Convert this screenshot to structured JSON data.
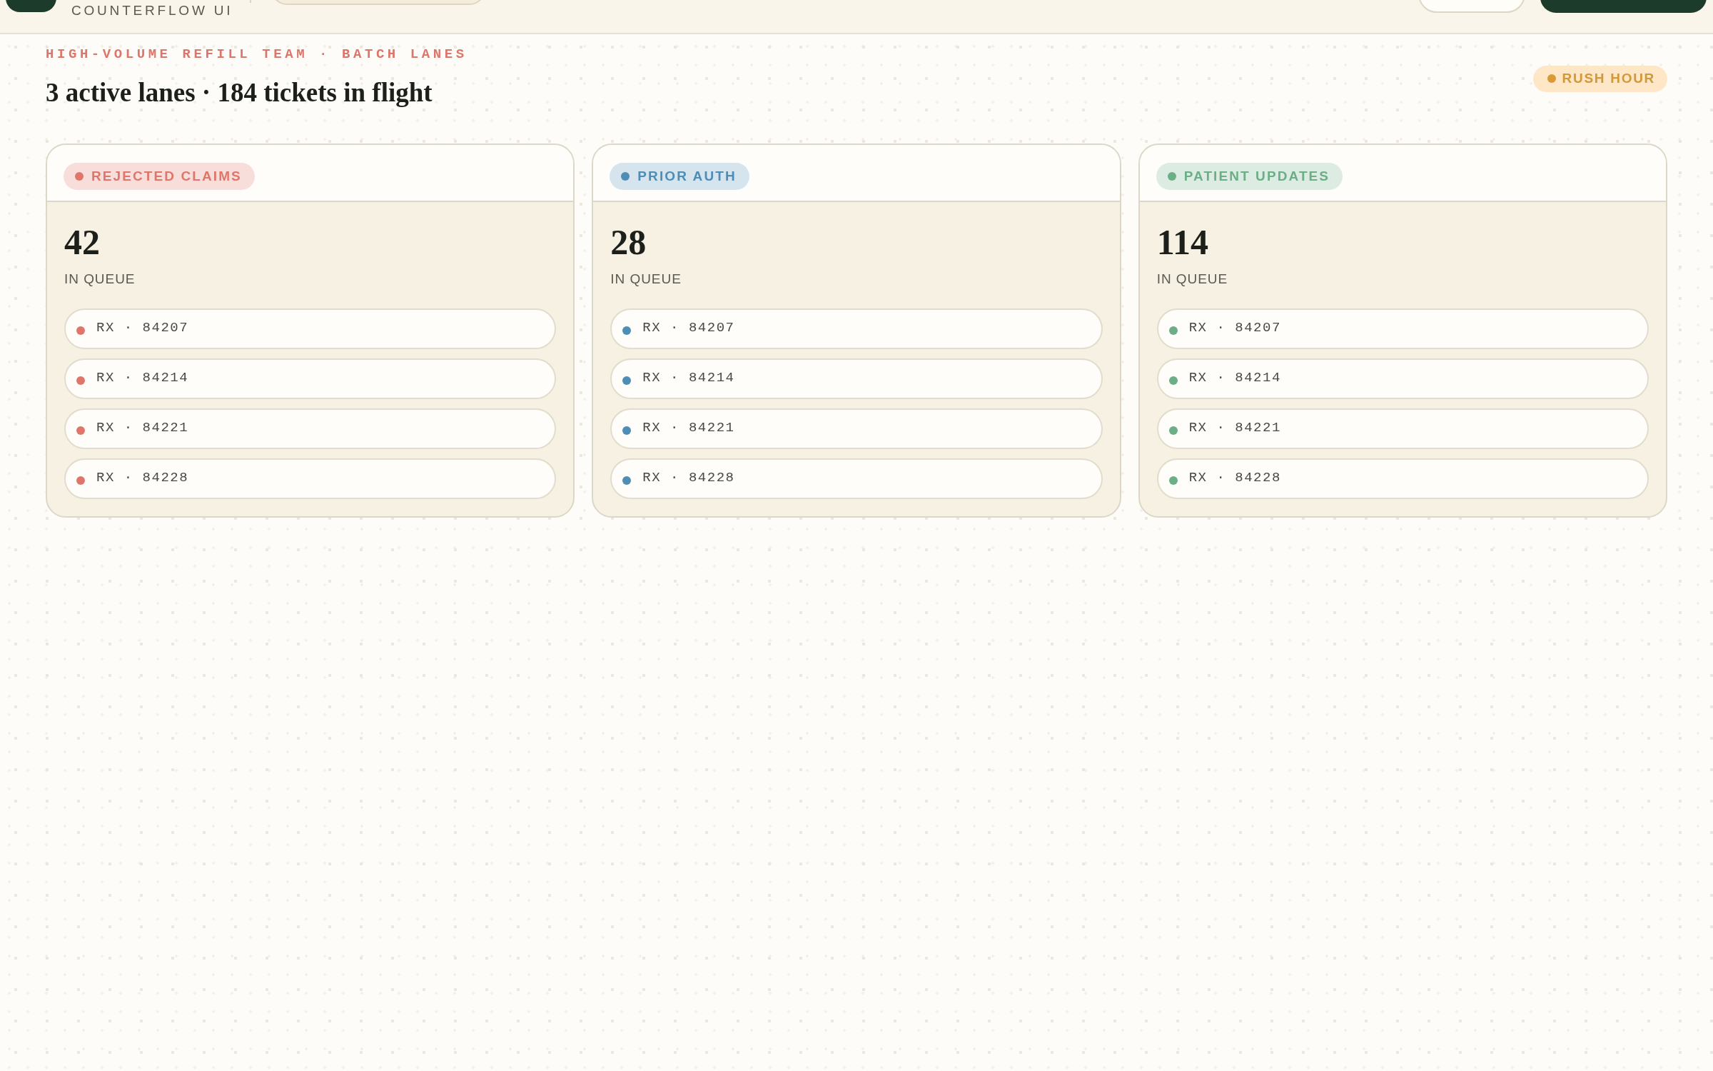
{
  "header": {
    "brand_subtitle": "COUNTERFLOW UI",
    "buttons": [
      {
        "kind": "outline"
      },
      {
        "kind": "primary"
      }
    ]
  },
  "page": {
    "eyebrow": "HIGH-VOLUME REFILL TEAM · BATCH LANES",
    "title": "3 active lanes · 184 tickets in flight",
    "status_badge": {
      "label": "RUSH HOUR"
    }
  },
  "lanes": [
    {
      "label": "REJECTED CLAIMS",
      "color": "#e0766a",
      "count": "42",
      "count_label": "IN QUEUE",
      "tickets": [
        "RX · 84207",
        "RX · 84214",
        "RX · 84221",
        "RX · 84228"
      ]
    },
    {
      "label": "PRIOR AUTH",
      "color": "#4e8db6",
      "count": "28",
      "count_label": "IN QUEUE",
      "tickets": [
        "RX · 84207",
        "RX · 84214",
        "RX · 84221",
        "RX · 84228"
      ]
    },
    {
      "label": "PATIENT UPDATES",
      "color": "#6cae86",
      "count": "114",
      "count_label": "IN QUEUE",
      "tickets": [
        "RX · 84207",
        "RX · 84214",
        "RX · 84221",
        "RX · 84228"
      ]
    }
  ]
}
